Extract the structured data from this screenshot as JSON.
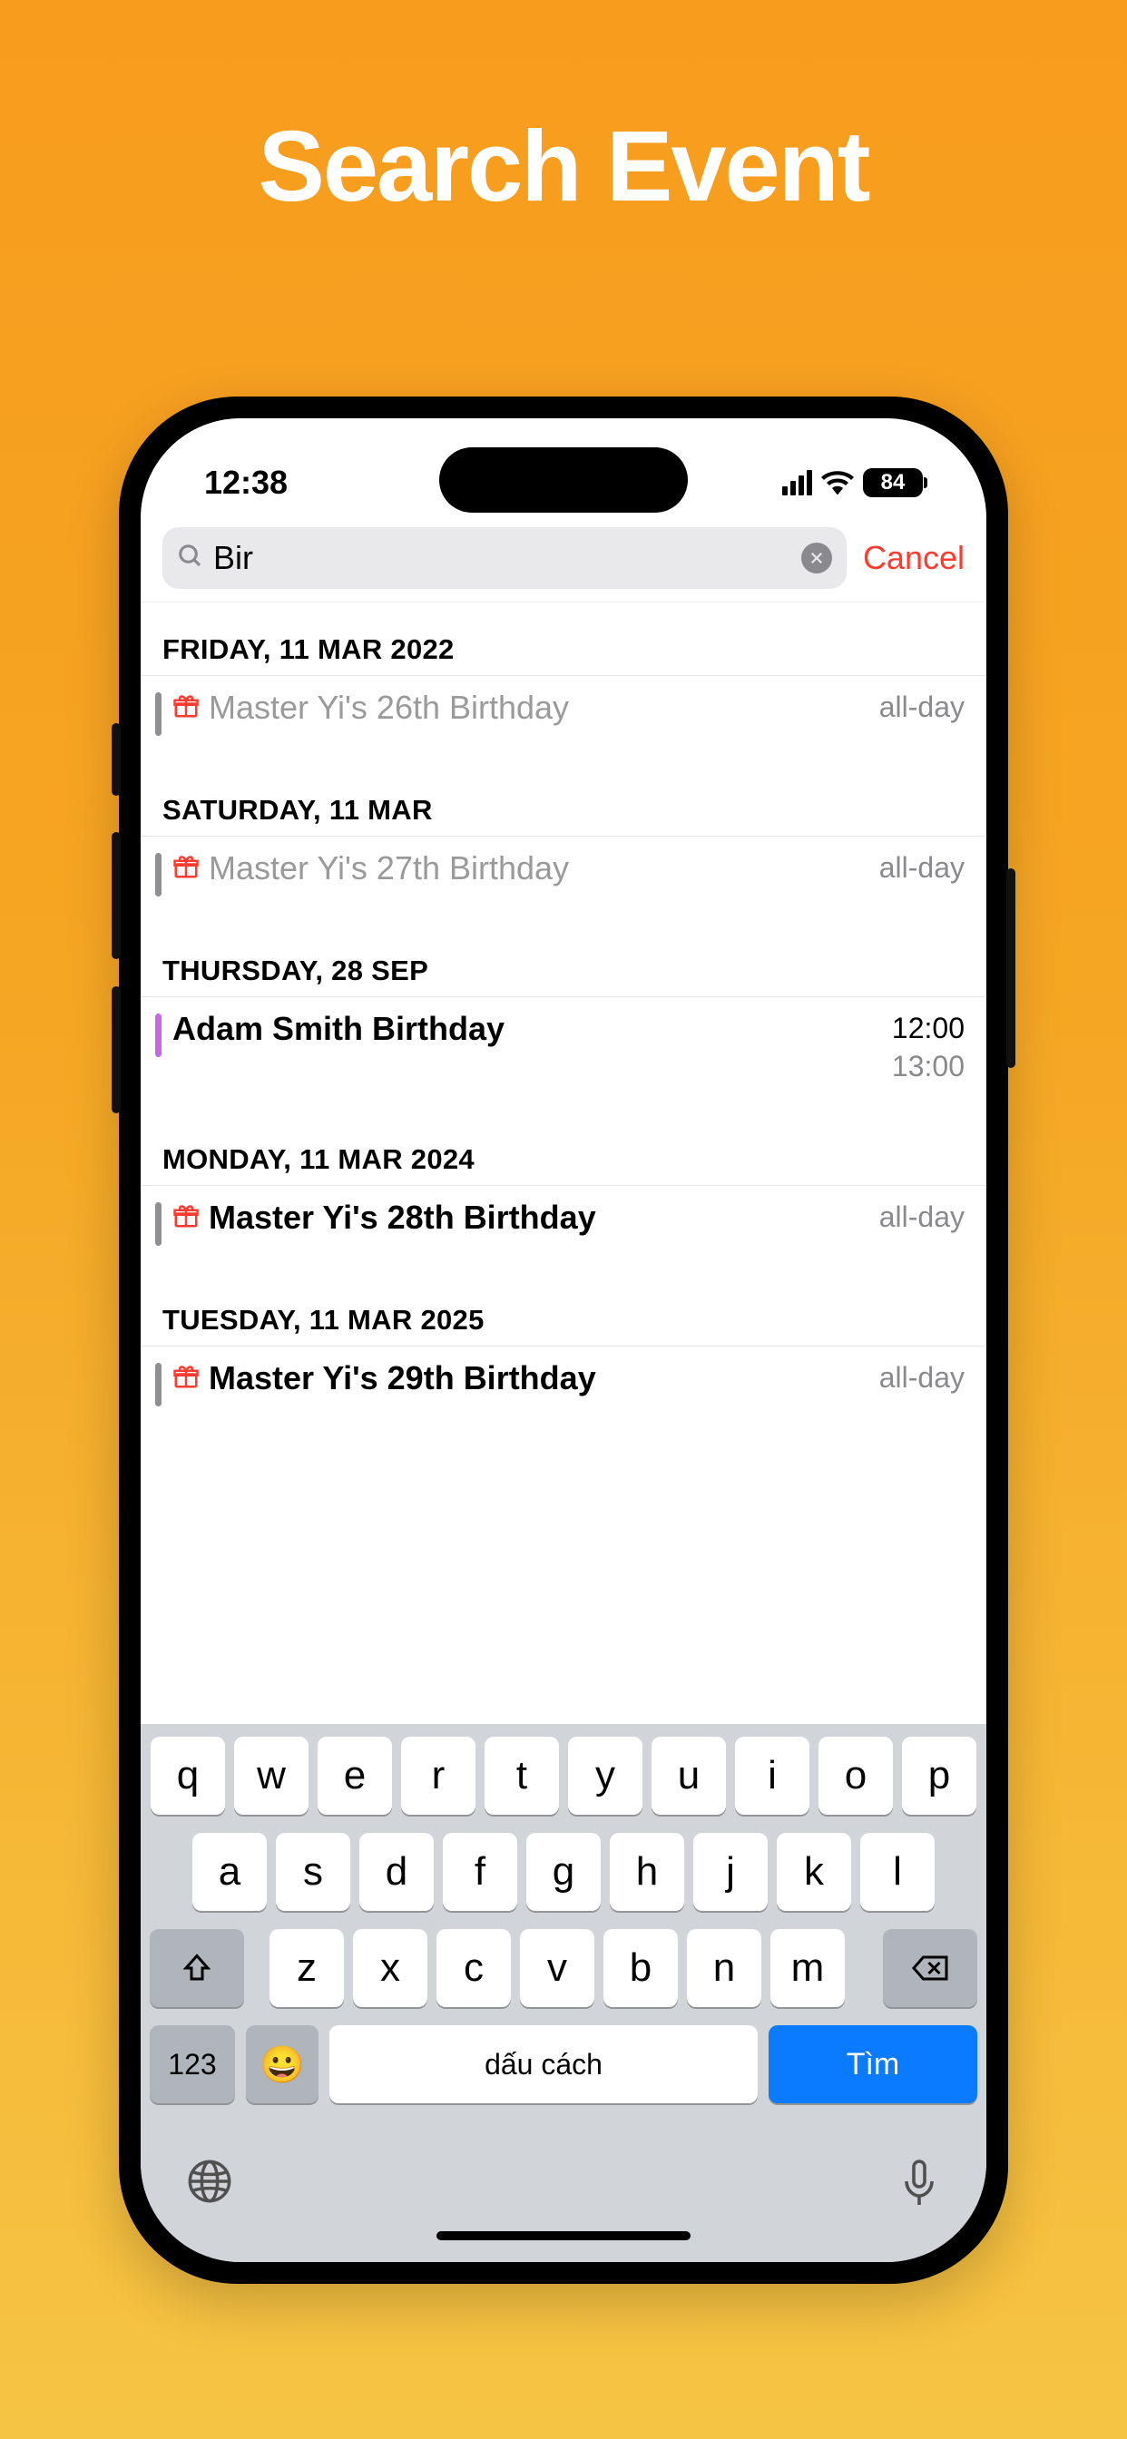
{
  "promo": {
    "title": "Search Event"
  },
  "statusbar": {
    "time": "12:38",
    "battery": "84"
  },
  "search": {
    "value": "Bir",
    "cancel": "Cancel"
  },
  "sections": [
    {
      "header": "FRIDAY, 11 MAR 2022",
      "events": [
        {
          "title": "Master Yi's 26th Birthday",
          "time1": "all-day",
          "time2": "",
          "dim": true,
          "gift": true,
          "bar": "#8e8e93"
        }
      ]
    },
    {
      "header": "SATURDAY, 11 MAR",
      "events": [
        {
          "title": "Master Yi's 27th Birthday",
          "time1": "all-day",
          "time2": "",
          "dim": true,
          "gift": true,
          "bar": "#8e8e93"
        }
      ]
    },
    {
      "header": "THURSDAY, 28 SEP",
      "events": [
        {
          "title": "Adam Smith Birthday",
          "time1": "12:00",
          "time2": "13:00",
          "dim": false,
          "gift": false,
          "bar": "#c867e6",
          "darktime": true,
          "bold": true
        }
      ]
    },
    {
      "header": "MONDAY, 11 MAR 2024",
      "events": [
        {
          "title": "Master Yi's 28th Birthday",
          "time1": "all-day",
          "time2": "",
          "dim": false,
          "gift": true,
          "bar": "#8e8e93",
          "bold": true
        }
      ]
    },
    {
      "header": "TUESDAY, 11 MAR 2025",
      "events": [
        {
          "title": "Master Yi's 29th Birthday",
          "time1": "all-day",
          "time2": "",
          "dim": false,
          "gift": true,
          "bar": "#8e8e93",
          "bold": true
        }
      ]
    }
  ],
  "keyboard": {
    "row1": [
      "q",
      "w",
      "e",
      "r",
      "t",
      "y",
      "u",
      "i",
      "o",
      "p"
    ],
    "row2": [
      "a",
      "s",
      "d",
      "f",
      "g",
      "h",
      "j",
      "k",
      "l"
    ],
    "row3": [
      "z",
      "x",
      "c",
      "v",
      "b",
      "n",
      "m"
    ],
    "num": "123",
    "space": "dấu cách",
    "search": "Tìm"
  }
}
